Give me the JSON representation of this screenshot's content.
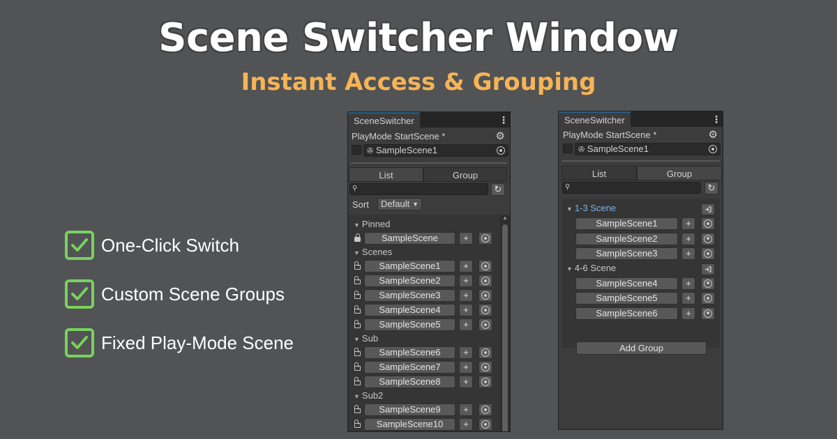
{
  "hero": {
    "title": "Scene Switcher Window",
    "subtitle": "Instant Access & Grouping"
  },
  "features": [
    {
      "label": "One-Click Switch",
      "icon": "checkmark-icon"
    },
    {
      "label": "Custom Scene Groups",
      "icon": "checkmark-icon"
    },
    {
      "label": "Fixed Play-Mode Scene",
      "icon": "checkmark-icon"
    }
  ],
  "colors": {
    "background": "#525355",
    "subtitle": "#f5b456",
    "check": "#78d35e",
    "group_label": "#7ab4ea"
  },
  "window_list": {
    "tab": "SceneSwitcher",
    "playmode_label": "PlayMode StartScene *",
    "start_scene": "SampleScene1",
    "tabs": [
      "List",
      "Group"
    ],
    "active_tab": "List",
    "sort_label": "Sort",
    "sort_value": "Default",
    "sections": [
      {
        "name": "Pinned",
        "items": [
          {
            "name": "SampleScene",
            "locked": true
          }
        ]
      },
      {
        "name": "Scenes",
        "items": [
          {
            "name": "SampleScene1",
            "locked": false
          },
          {
            "name": "SampleScene2",
            "locked": false
          },
          {
            "name": "SampleScene3",
            "locked": false
          },
          {
            "name": "SampleScene4",
            "locked": false
          },
          {
            "name": "SampleScene5",
            "locked": false
          }
        ]
      },
      {
        "name": "Sub",
        "items": [
          {
            "name": "SampleScene6",
            "locked": false
          },
          {
            "name": "SampleScene7",
            "locked": false
          },
          {
            "name": "SampleScene8",
            "locked": false
          }
        ]
      },
      {
        "name": "Sub2",
        "items": [
          {
            "name": "SampleScene9",
            "locked": false
          },
          {
            "name": "SampleScene10",
            "locked": false
          }
        ]
      }
    ]
  },
  "window_group": {
    "tab": "SceneSwitcher",
    "playmode_label": "PlayMode StartScene *",
    "start_scene": "SampleScene1",
    "tabs": [
      "List",
      "Group"
    ],
    "active_tab": "Group",
    "groups": [
      {
        "name": "1-3 Scene",
        "selected": true,
        "items": [
          "SampleScene1",
          "SampleScene2",
          "SampleScene3"
        ]
      },
      {
        "name": "4-6 Scene",
        "selected": false,
        "items": [
          "SampleScene4",
          "SampleScene5",
          "SampleScene6"
        ]
      }
    ],
    "add_group_label": "Add Group"
  },
  "glyphs": {
    "plus": "+",
    "kebab": "⋮",
    "gear": "⚙",
    "search": "🔍",
    "refresh": "↻",
    "triangle": "▼",
    "unity": "✇"
  }
}
